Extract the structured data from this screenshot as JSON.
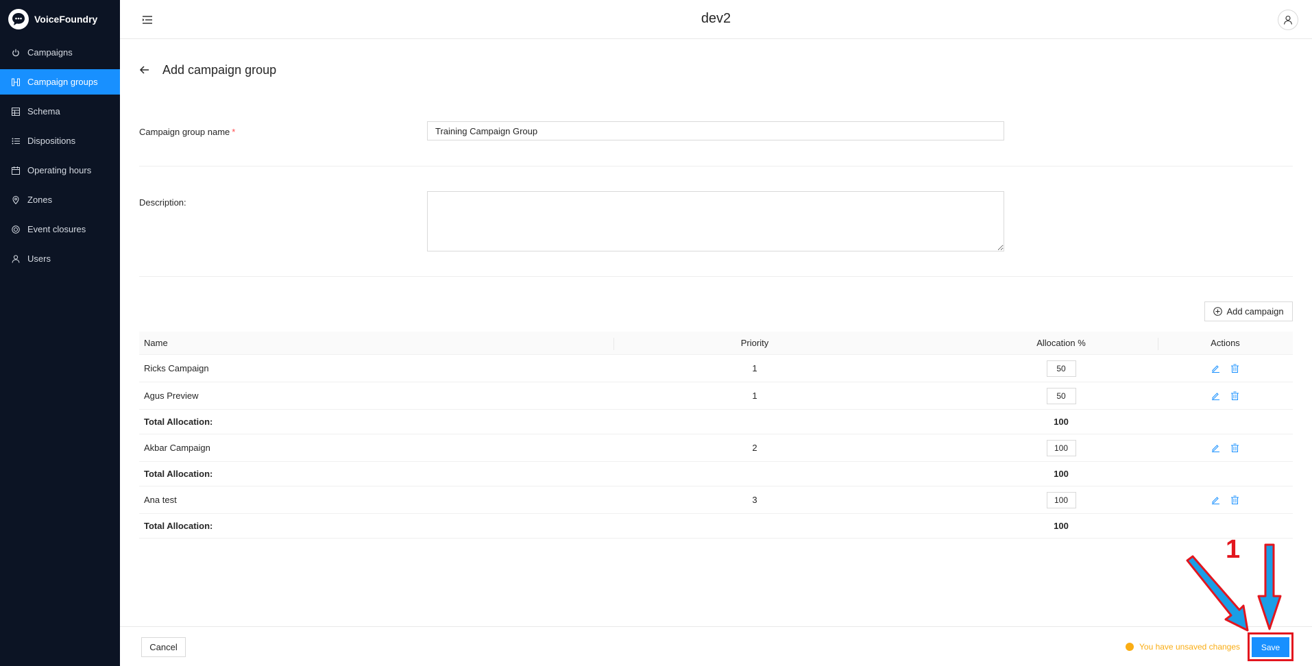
{
  "brand": {
    "name": "VoiceFoundry"
  },
  "sidebar": {
    "items": [
      {
        "label": "Campaigns",
        "icon": "power-icon",
        "active": false
      },
      {
        "label": "Campaign groups",
        "icon": "group-icon",
        "active": true
      },
      {
        "label": "Schema",
        "icon": "table-icon",
        "active": false
      },
      {
        "label": "Dispositions",
        "icon": "list-icon",
        "active": false
      },
      {
        "label": "Operating hours",
        "icon": "calendar-icon",
        "active": false
      },
      {
        "label": "Zones",
        "icon": "location-icon",
        "active": false
      },
      {
        "label": "Event closures",
        "icon": "target-icon",
        "active": false
      },
      {
        "label": "Users",
        "icon": "user-icon",
        "active": false
      }
    ]
  },
  "header": {
    "title": "dev2"
  },
  "page": {
    "title": "Add campaign group"
  },
  "form": {
    "name_label": "Campaign group name",
    "required_mark": "*",
    "name_value": "Training Campaign Group",
    "description_label": "Description:",
    "description_value": ""
  },
  "add_campaign_label": "Add campaign",
  "table": {
    "headers": {
      "name": "Name",
      "priority": "Priority",
      "allocation": "Allocation %",
      "actions": "Actions"
    },
    "total_label": "Total Allocation:",
    "rows": [
      {
        "type": "campaign",
        "name": "Ricks Campaign",
        "priority": "1",
        "allocation": "50"
      },
      {
        "type": "campaign",
        "name": "Agus Preview",
        "priority": "1",
        "allocation": "50"
      },
      {
        "type": "total",
        "value": "100"
      },
      {
        "type": "campaign",
        "name": "Akbar Campaign",
        "priority": "2",
        "allocation": "100"
      },
      {
        "type": "total",
        "value": "100"
      },
      {
        "type": "campaign",
        "name": "Ana test",
        "priority": "3",
        "allocation": "100"
      },
      {
        "type": "total",
        "value": "100"
      }
    ]
  },
  "footer": {
    "cancel_label": "Cancel",
    "unsaved_text": "You have unsaved changes",
    "save_label": "Save"
  },
  "annotation": {
    "step_number": "1"
  },
  "colors": {
    "primary": "#1890ff",
    "sidebar_bg": "#0c1424",
    "warning": "#faad14",
    "annotation_red": "#e3161e",
    "annotation_blue": "#1a9ee6"
  }
}
